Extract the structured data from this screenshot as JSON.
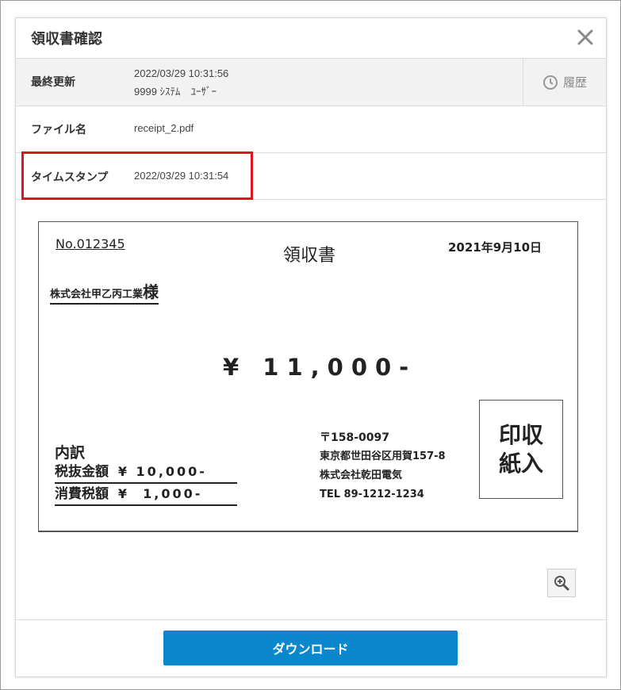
{
  "modal": {
    "title": "領収書確認",
    "close_icon": "close-icon"
  },
  "info": {
    "last_updated_label": "最終更新",
    "last_updated_datetime": "2022/03/29 10:31:56",
    "last_updated_user": "9999 ｼｽﾃﾑ　ﾕｰｻﾞｰ",
    "history_label": "履歴",
    "history_icon": "clock-icon",
    "filename_label": "ファイル名",
    "filename_value": "receipt_2.pdf",
    "timestamp_label": "タイムスタンプ",
    "timestamp_value": "2022/03/29 10:31:54",
    "highlight_color": "#e0141e"
  },
  "receipt": {
    "number": "No.012345",
    "title": "領収書",
    "date": "2021年9月10日",
    "addressee": "株式会社甲乙丙工業",
    "honorific": "様",
    "amount": "¥ 11,000-",
    "breakdown_title": "内訳",
    "tax_excluded_label": "税抜金額",
    "tax_excluded_amount": "¥ 10,000-",
    "tax_label": "消費税額",
    "tax_amount": "¥  1,000-",
    "postal_code": "〒158-0097",
    "address": "東京都世田谷区用賀157-8",
    "company": "株式会社乾田電気",
    "tel": "TEL 89-1212-1234",
    "stamp_line1": "印収",
    "stamp_line2": "紙入"
  },
  "zoom": {
    "icon": "zoom-in-icon"
  },
  "footer": {
    "download_label": "ダウンロード",
    "accent_color": "#0b87cd"
  }
}
